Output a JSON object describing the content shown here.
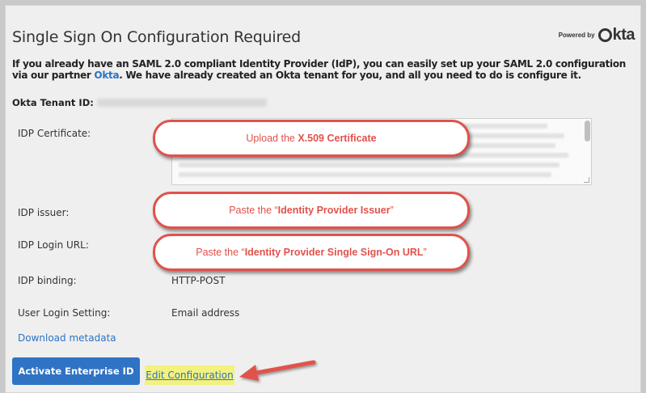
{
  "panel": {
    "title": "Single Sign On Configuration Required",
    "powered_by": "Powered by",
    "brand": "kta",
    "intro_text": "If you already have an SAML 2.0 compliant Identity Provider (IdP), you can easily set up your SAML 2.0 configuration via our partner ",
    "intro_link": "Okta",
    "intro_text_2": ". We have already created an Okta tenant for you, and all you need to do is configure it.",
    "tenant_label": "Okta Tenant ID:"
  },
  "fields": [
    {
      "label": "IDP Certificate:"
    },
    {
      "label": "IDP issuer:"
    },
    {
      "label": "IDP Login URL:"
    },
    {
      "label": "IDP binding:",
      "value": "HTTP-POST"
    },
    {
      "label": "User Login Setting:",
      "value": "Email address"
    }
  ],
  "callouts": [
    {
      "prefix": "Upload the ",
      "bold": "X.509 Certificate",
      "suffix": ""
    },
    {
      "prefix": "Paste the “",
      "bold": "Identity Provider Issuer",
      "suffix": "”"
    },
    {
      "prefix": "Paste the “",
      "bold": "Identity Provider Single Sign-On URL",
      "suffix": "”"
    }
  ],
  "links": {
    "download_metadata": "Download metadata",
    "edit_configuration": "Edit Configuration"
  },
  "buttons": {
    "activate": "Activate Enterprise ID"
  },
  "colors": {
    "accent": "#2f73c4",
    "link": "#2a73c5",
    "callout": "#e0524b",
    "highlight": "#f3f27e"
  }
}
